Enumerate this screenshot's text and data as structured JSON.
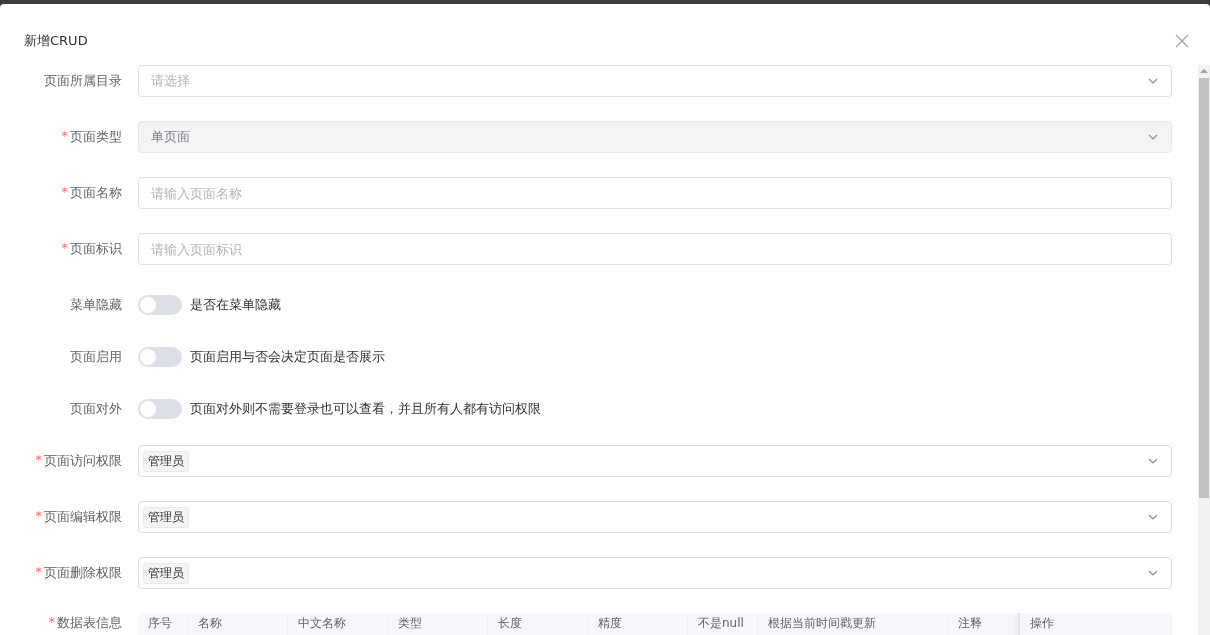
{
  "dialog": {
    "title": "新增CRUD",
    "fields": [
      {
        "kind": "select",
        "label": "页面所属目录",
        "placeholder": "请选择",
        "disabled": false
      },
      {
        "kind": "select",
        "label": "页面类型",
        "mark": "*",
        "value": "单页面",
        "disabled": true
      },
      {
        "kind": "input",
        "label": "页面名称",
        "mark": "*",
        "placeholder": "请输入页面名称"
      },
      {
        "kind": "input",
        "label": "页面标识",
        "mark": "*",
        "placeholder": "请输入页面标识"
      },
      {
        "kind": "switch",
        "label": "菜单隐藏",
        "on": false,
        "hint": "是否在菜单隐藏"
      },
      {
        "kind": "switch",
        "label": "页面启用",
        "on": false,
        "hint": "页面启用与否会决定页面是否展示"
      },
      {
        "kind": "switch",
        "label": "页面对外",
        "on": false,
        "hint": "页面对外则不需要登录也可以查看，并且所有人都有访问权限"
      },
      {
        "kind": "tags",
        "label": "页面访问权限",
        "mark": "*",
        "tags": [
          "管理员"
        ]
      },
      {
        "kind": "tags",
        "label": "页面编辑权限",
        "mark": "*",
        "tags": [
          "管理员"
        ]
      },
      {
        "kind": "tags",
        "label": "页面删除权限",
        "mark": "*",
        "tags": [
          "管理员"
        ]
      },
      {
        "kind": "table",
        "label": "数据表信息",
        "mark": "*",
        "columns": [
          "序号",
          "名称",
          "中文名称",
          "类型",
          "长度",
          "精度",
          "不是null",
          "根据当前时间戳更新",
          "注释",
          "操作"
        ]
      }
    ]
  }
}
